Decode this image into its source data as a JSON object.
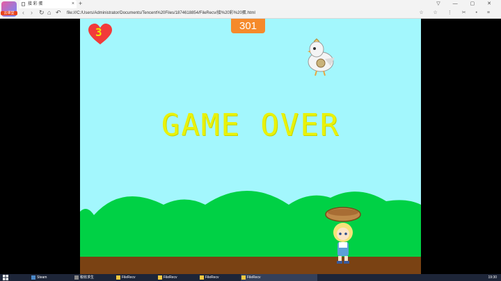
{
  "browser": {
    "tab_title": "接 彩 蛋",
    "tab_close": "×",
    "new_tab": "+",
    "logo_text": "云课堂",
    "url": "file:///C:/Users/Administrator/Documents/Tencent%20Files/1874618854/FileRecv/接%20彩%20蛋.html",
    "nav_back": "‹",
    "nav_forward": "›",
    "nav_reload": "↻",
    "nav_home": "⌂",
    "nav_undo": "↶",
    "window_controls": "▽ — ▢ ✕",
    "toolbar_icons": "☆ ☆ ⋮ ✂ • ≡"
  },
  "game": {
    "score": "301",
    "lives": "3",
    "message": "GAME OVER",
    "colors": {
      "sky": "#a3f7fd",
      "hills": "#00d145",
      "ground": "#7a4213",
      "score_bg": "#f58a2b",
      "heart": "#f23a3a",
      "text": "#e9f20a"
    },
    "icons": [
      "heart-icon",
      "chicken-sprite",
      "girl-with-basket-sprite"
    ]
  },
  "taskbar": {
    "items": [
      {
        "label": "Steam"
      },
      {
        "label": "税收求生"
      },
      {
        "label": "FileRecv"
      },
      {
        "label": "FileRecv"
      },
      {
        "label": "FileRecv"
      },
      {
        "label": "FileRecv"
      }
    ],
    "clock": "19:30"
  }
}
